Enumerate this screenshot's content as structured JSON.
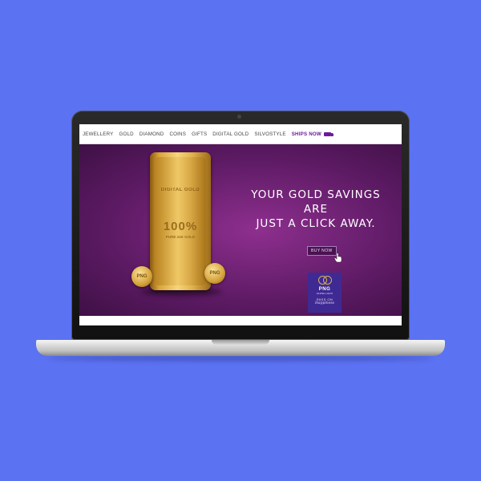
{
  "nav": {
    "items": [
      "JEWELLERY",
      "GOLD",
      "DIAMOND",
      "COINS",
      "GIFTS",
      "DIGITAL GOLD",
      "SILVOSTYLE"
    ],
    "ships_now": "SHIPS NOW"
  },
  "banner": {
    "headline_line1": "YOUR GOLD SAVINGS ARE",
    "headline_line2": "JUST A CLICK AWAY.",
    "buy_button": "BUY NOW",
    "bar_brand": "DIGITAL GOLD",
    "bar_purity": "100%",
    "bar_sub": "PURE 24K GOLD",
    "coin_text": "PNG"
  },
  "logo": {
    "name": "PNG",
    "sub": "JEWELLERS",
    "tagline1": "PASS ON",
    "tagline2": "Happiness"
  },
  "colors": {
    "background": "#5b72f2",
    "banner_purple": "#8e2f8f",
    "accent_purple": "#6a1b9a",
    "logo_bg": "#3f2a93"
  }
}
